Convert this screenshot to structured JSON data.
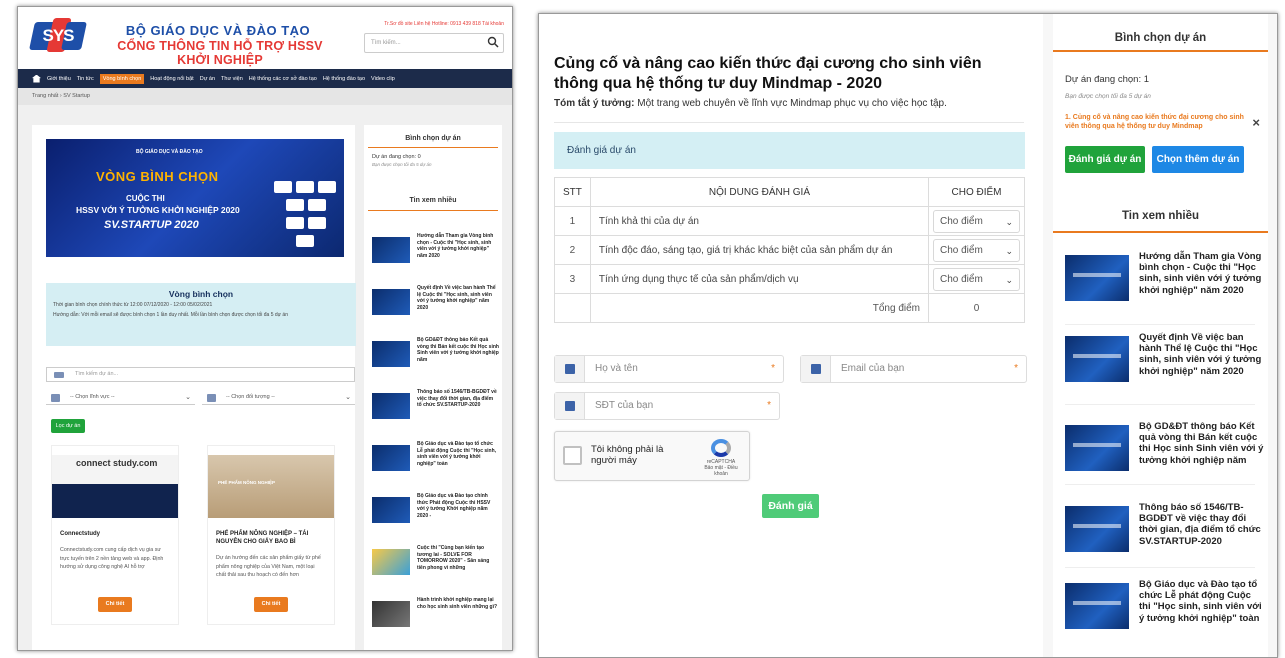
{
  "left": {
    "logo_text": "SYS",
    "ministry": "BỘ GIÁO DỤC VÀ ĐÀO TẠO",
    "portal": "CỔNG THÔNG TIN HỖ TRỢ HSSV KHỞI NGHIỆP",
    "toplinks": "Tr.Sơ đồ site  Liên hệ  Hotline: 0913 439 818  Tài khoản",
    "search_placeholder": "Tìm kiếm...",
    "nav": [
      "Giới thiệu",
      "Tin tức",
      "Vòng bình chọn",
      "Hoạt động nổi bật",
      "Dự án",
      "Thư viện",
      "Hệ thống các cơ sở đào tạo",
      "Hệ thống đào tạo",
      "Video clip"
    ],
    "breadcrumb": "Trang nhất  ›  SV Startup",
    "banner": {
      "ministry": "BỘ GIÁO DỤC VÀ ĐÀO TẠO",
      "round": "VÒNG BÌNH CHỌN",
      "contest": "CUỘC THI",
      "contest_name": "HSSV VỚI Ý TƯỞNG KHỞI NGHIỆP 2020",
      "brand": "SV.STARTUP 2020"
    },
    "vote_box": {
      "title": "Vòng bình chọn",
      "time": "Thời gian bình chọn chính thức từ 12:00 07/12/2020 - 12:00 05/02/2021",
      "guide": "Hướng dẫn: Với mỗi email sẽ được bình chọn 1 lần duy nhất. Mỗi lần bình chọn được chọn tối đa 5 dự án"
    },
    "search_project_placeholder": "Tìm kiếm dự án...",
    "select_field": "-- Chọn lĩnh vực --",
    "select_target": "-- Chọn đối tượng --",
    "filter_button": "Lọc dự án",
    "cards": [
      {
        "title": "Connectstudy",
        "desc": "Connectstudy.com cung cấp dịch vụ gia sư trực tuyến trên 2 nền tảng web và app. Định hướng sử dụng công nghệ AI hỗ trợ",
        "button": "Chi tiết",
        "img_text": "connect study.com"
      },
      {
        "title": "PHẾ PHẨM NÔNG NGHIỆP – TÁI NGUYÊN CHO GIẤY BAO BÌ",
        "desc": "Dự án hướng đến các sản phẩm giấy từ phế phẩm nông nghiệp của Việt Nam, một loại chất thải sau thu hoạch có đến hơn",
        "button": "Chi tiết",
        "img_text": "PHẾ PHẨM NÔNG NGHIỆP"
      }
    ],
    "sidebar": {
      "vote_title": "Bình chọn dự án",
      "selected": "Dự án đang chọn: 0",
      "note": "Bạn được chọn tối đa 5 dự án",
      "news_title": "Tin xem nhiều",
      "news": [
        "Hướng dẫn Tham gia Vòng bình chọn - Cuộc thi \"Học sinh, sinh viên với ý tưởng khởi nghiệp\" năm 2020",
        "Quyết định Về việc ban hành Thể lệ Cuộc thi \"Học sinh, sinh viên với ý tưởng khởi nghiệp\" năm 2020",
        "Bộ GD&ĐT thông báo Kết quả vòng thi Bán kết cuộc thi Học sinh Sinh viên với ý tưởng khởi nghiệp năm",
        "Thông báo số 1546/TB-BGDĐT về việc thay đổi thời gian, địa điểm tổ chức SV.STARTUP-2020",
        "Bộ Giáo dục và Đào tạo tổ chức Lễ phát động Cuộc thi \"Học sinh, sinh viên với ý tưởng khởi nghiệp\" toàn",
        "Bộ Giáo dục và Đào tạo chính thức Phát động Cuộc thi HSSV với ý tưởng Khởi nghiệp năm 2020 -",
        "Cuộc thi \"Cùng bạn kiến tạo tương lai - SOLVE FOR TOMORROW 2020\" - Sân sáng tiên phong vì những",
        "Hành trình khởi nghiệp mang lại cho học sinh sinh viên những gì?"
      ]
    }
  },
  "right": {
    "title": "Củng cố và nâng cao kiến thức đại cương cho sinh viên thông qua hệ thống tư duy Mindmap - 2020",
    "summary_label": "Tóm tắt ý tưởng:",
    "summary": "Một trang web chuyên về lĩnh vực Mindmap phục vụ cho việc học tập.",
    "eval_header": "Đánh giá dự án",
    "table": {
      "headers": [
        "STT",
        "NỘI DUNG ĐÁNH GIÁ",
        "CHO ĐIỂM"
      ],
      "rows": [
        {
          "stt": "1",
          "content": "Tính khả thi của dự án",
          "select": "Cho điểm"
        },
        {
          "stt": "2",
          "content": "Tính độc đáo, sáng tạo, giá trị khác khác biệt của sản phẩm dự án",
          "select": "Cho điểm"
        },
        {
          "stt": "3",
          "content": "Tính ứng dụng thực tế của sản phẩm/dịch vụ",
          "select": "Cho điểm"
        }
      ],
      "total_label": "Tổng điểm",
      "total_value": "0"
    },
    "form": {
      "name_placeholder": "Họ và tên",
      "email_placeholder": "Email của bạn",
      "phone_placeholder": "SĐT của bạn",
      "required_mark": "*"
    },
    "captcha": {
      "label": "Tôi không phải là người máy",
      "brand": "reCAPTCHA",
      "links": "Bảo mật - Điều khoản"
    },
    "submit": "Đánh giá",
    "sidebar": {
      "vote_title": "Bình chọn dự án",
      "selected": "Dự án đang chọn: 1",
      "note": "Bạn được chọn tối đa 5 dự án",
      "picked": "1. Củng cố và nâng cao kiến thức đại cương cho sinh viên thông qua hệ thống tư duy Mindmap",
      "remove": "×",
      "btn_eval": "Đánh giá dự án",
      "btn_more": "Chọn thêm dự án",
      "news_title": "Tin xem nhiều",
      "news": [
        "Hướng dẫn Tham gia Vòng bình chọn - Cuộc thi \"Học sinh, sinh viên với ý tưởng khởi nghiệp\" năm 2020",
        "Quyết định Về việc ban hành Thể lệ Cuộc thi \"Học sinh, sinh viên với ý tưởng khởi nghiệp\" năm 2020",
        "Bộ GD&ĐT thông báo Kết quả vòng thi Bán kết cuộc thi Học sinh Sinh viên với ý tưởng khởi nghiệp năm",
        "Thông báo số 1546/TB-BGDĐT về việc thay đổi thời gian, địa điểm tổ chức SV.STARTUP-2020",
        "Bộ Giáo dục và Đào tạo tổ chức Lễ phát động Cuộc thi \"Học sinh, sinh viên với ý tưởng khởi nghiệp\" toàn"
      ]
    }
  }
}
